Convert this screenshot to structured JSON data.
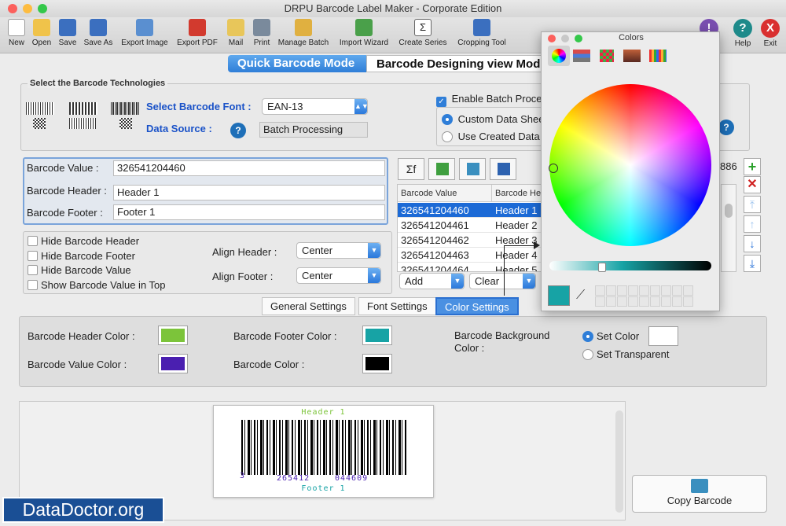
{
  "window": {
    "title": "DRPU Barcode Label Maker - Corporate Edition"
  },
  "toolbar": {
    "items": [
      {
        "label": "New",
        "icon": "new-document-icon"
      },
      {
        "label": "Open",
        "icon": "open-folder-icon"
      },
      {
        "label": "Save",
        "icon": "save-disk-icon"
      },
      {
        "label": "Save As",
        "icon": "save-as-icon"
      },
      {
        "label": "Export Image",
        "icon": "export-image-icon"
      },
      {
        "label": "Export PDF",
        "icon": "export-pdf-icon"
      },
      {
        "label": "Mail",
        "icon": "mail-icon"
      },
      {
        "label": "Print",
        "icon": "printer-icon"
      },
      {
        "label": "Manage Batch",
        "icon": "manage-batch-icon"
      },
      {
        "label": "Import Wizard",
        "icon": "import-wizard-icon"
      },
      {
        "label": "Create Series",
        "icon": "create-series-icon"
      },
      {
        "label": "Cropping Tool",
        "icon": "cropping-tool-icon"
      }
    ],
    "right": [
      {
        "label": "s",
        "icon": "info-icon",
        "color": "#7a4fb0"
      },
      {
        "label": "Help",
        "icon": "help-icon",
        "color": "#1e8a8a"
      },
      {
        "label": "Exit",
        "icon": "exit-icon",
        "color": "#d93030"
      }
    ]
  },
  "modes": {
    "quick": "Quick Barcode Mode",
    "designing": "Barcode Designing view Mod"
  },
  "technologies": {
    "legend": "Select the Barcode Technologies",
    "font_label": "Select Barcode Font :",
    "font_value": "EAN-13",
    "source_label": "Data Source :",
    "source_value": "Batch Processing",
    "enable_batch": "Enable Batch Proce",
    "custom_data": "Custom Data Shee",
    "created_data": "Use Created Data"
  },
  "fields": {
    "value_label": "Barcode Value :",
    "value": "326541204460",
    "header_label": "Barcode Header :",
    "header": "Header 1",
    "footer_label": "Barcode Footer :",
    "footer": "Footer 1"
  },
  "options": {
    "hide_header": "Hide Barcode Header",
    "hide_footer": "Hide Barcode Footer",
    "hide_value": "Hide Barcode Value",
    "show_top": "Show Barcode Value in Top",
    "align_header_label": "Align Header :",
    "align_header": "Center",
    "align_footer_label": "Align Footer :",
    "align_footer": "Center"
  },
  "table": {
    "columns": [
      "Barcode Value",
      "Barcode He"
    ],
    "rows": [
      [
        "326541204460",
        "Header 1"
      ],
      [
        "326541204461",
        "Header 2"
      ],
      [
        "326541204462",
        "Header 3"
      ],
      [
        "326541204463",
        "Header 4"
      ],
      [
        "326541204464",
        "Header 5"
      ]
    ],
    "count_partial": "886",
    "add_label": "Add",
    "clear_label": "Clear"
  },
  "settings_tabs": [
    "General Settings",
    "Font Settings",
    "Color Settings"
  ],
  "colors_section": {
    "header_color_label": "Barcode Header Color :",
    "header_color": "#7cc43a",
    "footer_color_label": "Barcode Footer Color :",
    "footer_color": "#17a3a5",
    "value_color_label": "Barcode Value Color :",
    "value_color": "#4a1fb0",
    "barcode_color_label": "Barcode Color :",
    "barcode_color": "#000000",
    "background_label": "Barcode Background Color :",
    "set_color": "Set Color",
    "set_transparent": "Set Transparent",
    "background_color": "#ffffff"
  },
  "preview": {
    "header": "Header 1",
    "footer": "Footer 1",
    "digit_first": "3",
    "digits_left": "265412",
    "digits_right": "044609"
  },
  "copy_barcode": "Copy Barcode",
  "colors_panel": {
    "title": "Colors",
    "selected_color": "#17a3a5"
  },
  "watermark": "DataDoctor.org"
}
